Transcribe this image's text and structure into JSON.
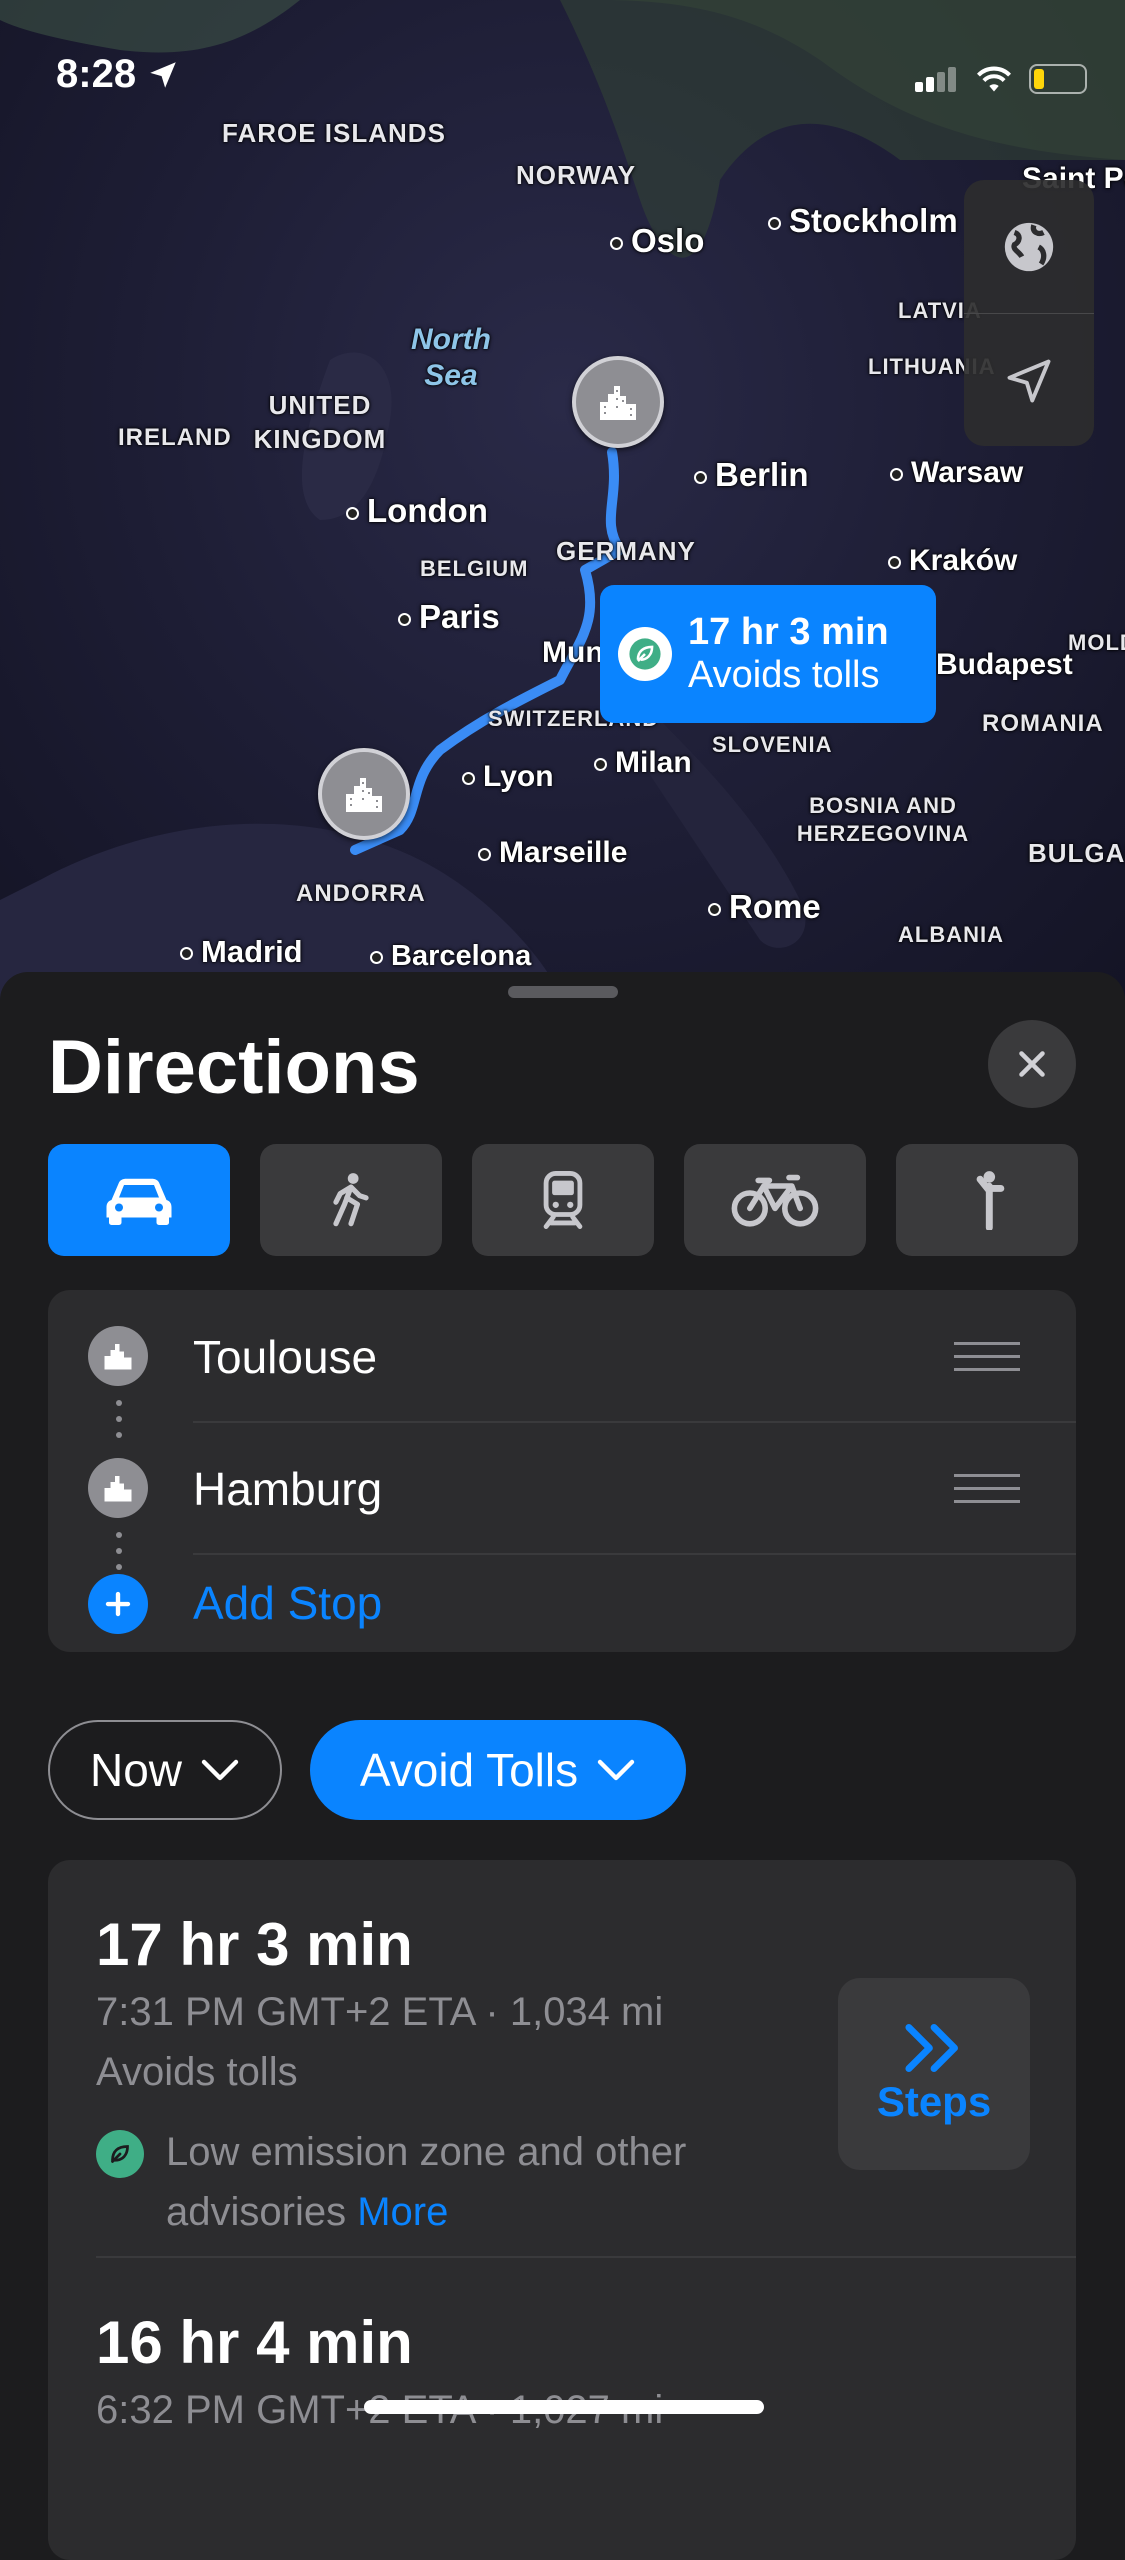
{
  "status_bar": {
    "time": "8:28"
  },
  "map": {
    "countries": [
      "FAROE ISLANDS",
      "NORWAY",
      "UNITED KINGDOM",
      "IRELAND",
      "BELGIUM",
      "GERMANY",
      "SWITZERLAND",
      "SLOVENIA",
      "BOSNIA AND HERZEGOVINA",
      "ROMANIA",
      "ANDORRA",
      "ALBANIA",
      "LATVIA",
      "LITHUANIA",
      "BULGARIA",
      "MOLDOVA"
    ],
    "cities": [
      "Oslo",
      "Stockholm",
      "Berlin",
      "Warsaw",
      "London",
      "Kraków",
      "Paris",
      "Munich",
      "Budapest",
      "Lyon",
      "Milan",
      "Marseille",
      "Rome",
      "Madrid",
      "Barcelona",
      "Saint Petersburg"
    ],
    "sea": "North Sea",
    "callout": {
      "time": "17 hr 3 min",
      "note": "Avoids tolls"
    }
  },
  "sheet": {
    "title": "Directions",
    "modes": [
      "car",
      "walk",
      "transit",
      "cycle",
      "ride-share"
    ],
    "active_mode": "car",
    "stops": [
      {
        "name": "Toulouse"
      },
      {
        "name": "Hamburg"
      }
    ],
    "add_stop": "Add Stop",
    "chips": {
      "now": "Now",
      "tolls": "Avoid Tolls"
    },
    "routes": [
      {
        "time": "17 hr 3 min",
        "eta": "7:31 PM GMT+2 ETA · 1,034 mi",
        "note": "Avoids tolls",
        "advisory": "Low emission zone and other advisories",
        "advisory_link": "More",
        "steps_label": "Steps"
      },
      {
        "time": "16 hr 4 min",
        "eta": "6:32 PM GMT+2 ETA · 1,027 mi"
      }
    ]
  },
  "colors": {
    "accent": "#0a84ff",
    "route": "#3a8cf5",
    "eco": "#3fae86"
  }
}
